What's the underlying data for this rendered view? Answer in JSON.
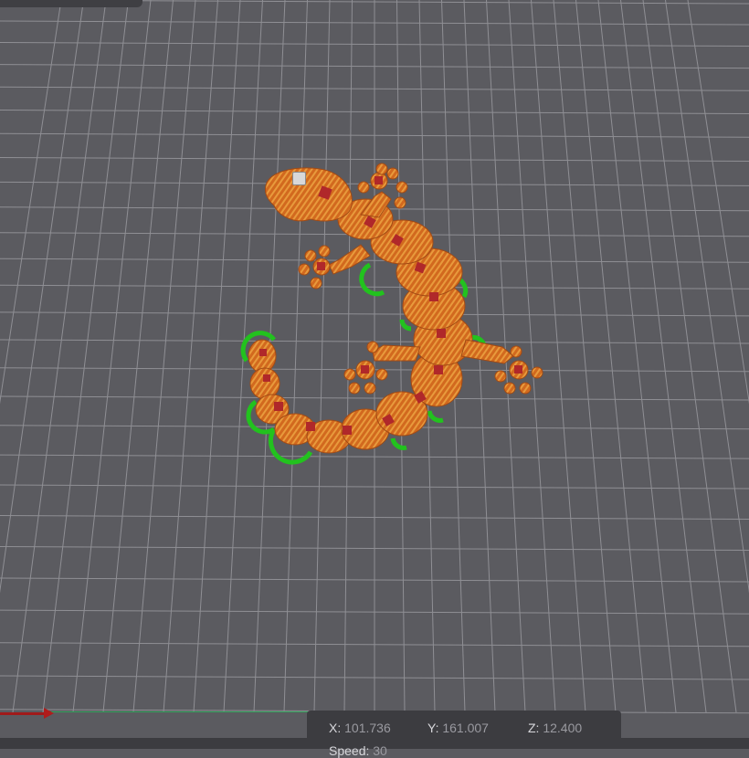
{
  "viewport": {
    "scene": "sliced preview",
    "colors": {
      "background": "#5b5b60",
      "grid": "#8f8f94",
      "model": "#d2691e",
      "model_highlight": "#e8a040",
      "model_inner": "#b0282a",
      "support_brim": "#22c21e",
      "x_axis": "#b01c1c",
      "y_axis": "#2fa35a"
    },
    "model_icon": "object-marker-icon"
  },
  "coordinates": {
    "x_label": "X:",
    "x_value": "101.736",
    "y_label": "Y:",
    "y_value": "161.007",
    "z_label": "Z:",
    "z_value": "12.400",
    "speed_label": "Speed:",
    "speed_value": "30"
  }
}
